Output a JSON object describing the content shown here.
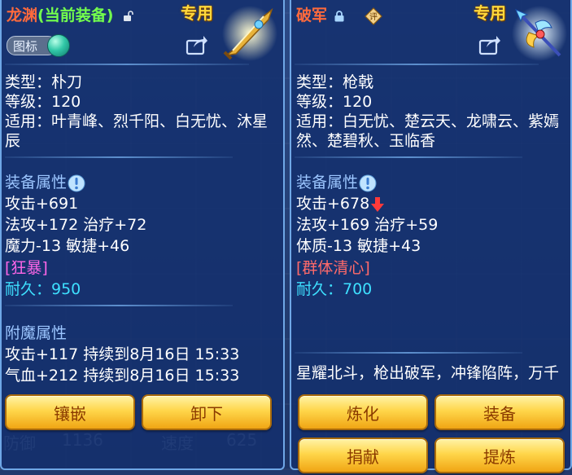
{
  "background": {
    "stat_defense_label": "防御",
    "stat_defense_value": "1136",
    "stat_speed_label": "速度",
    "stat_speed_value": "625"
  },
  "left": {
    "name": "龙渊",
    "status": "(当前装备)",
    "exclusive_tag": "专用",
    "icon_toggle_label": "图标",
    "type_line": "类型：朴刀",
    "level_line": "等级：120",
    "fit_line": "适用：叶青峰、烈千阳、白无忧、沐星辰",
    "attr_title": "装备属性",
    "stats": [
      "攻击+691",
      "法攻+172 治疗+72",
      "魔力-13 敏捷+46"
    ],
    "special": "[狂暴]",
    "durability": "耐久：950",
    "enchant_title": "附魔属性",
    "enchants": [
      "攻击+117 持续到8月16日 15:33",
      "气血+212 持续到8月16日 15:33"
    ],
    "buttons": [
      "镶嵌",
      "卸下"
    ]
  },
  "right": {
    "name": "破军",
    "exclusive_tag": "专用",
    "type_line": "类型：枪戟",
    "level_line": "等级：120",
    "fit_line": "适用：白无忧、楚云天、龙啸云、紫嫣然、楚碧秋、玉临香",
    "attr_title": "装备属性",
    "stats": [
      "攻击+678",
      "法攻+169 治疗+59",
      "体质-13 敏捷+43"
    ],
    "special": "[群体清心]",
    "durability": "耐久：700",
    "description": "星耀北斗，枪出破军，冲锋陷阵，万千壁垒",
    "buttons": [
      "炼化",
      "装备",
      "捐献",
      "提炼"
    ]
  },
  "colors": {
    "name": "#ff6a3c",
    "current_equip": "#73ff4d",
    "exclusive": "#ffd83c",
    "section_title": "#9cc6ff",
    "durability": "#3ee0ff",
    "special_left": "#ff66e8",
    "special_right": "#ff6a6a",
    "button_text": "#8a3a00"
  },
  "icons": [
    "lock-icon",
    "evaluate-icon",
    "share-icon",
    "info-icon",
    "down-arrow-icon",
    "sword-item-icon",
    "spear-item-icon"
  ]
}
